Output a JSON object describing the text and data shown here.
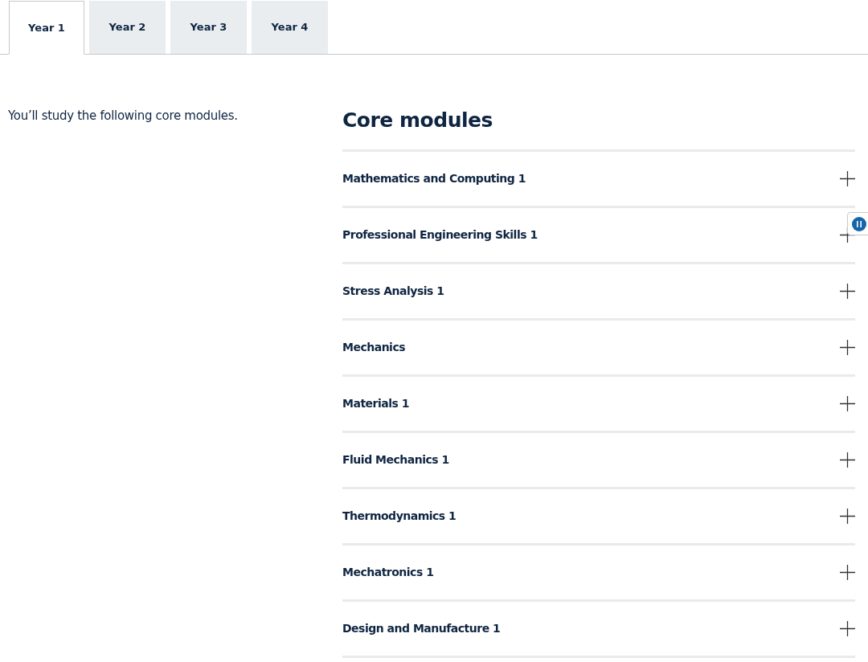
{
  "tabs": [
    {
      "label": "Year 1",
      "selected": true
    },
    {
      "label": "Year 2",
      "selected": false
    },
    {
      "label": "Year 3",
      "selected": false
    },
    {
      "label": "Year 4",
      "selected": false
    }
  ],
  "intro": "You’ll study the following core modules.",
  "section_title": "Core modules",
  "modules": [
    {
      "title": "Mathematics and Computing 1",
      "expanded": false
    },
    {
      "title": "Professional Engineering Skills 1",
      "expanded": false
    },
    {
      "title": "Stress Analysis 1",
      "expanded": false
    },
    {
      "title": "Mechanics",
      "expanded": false
    },
    {
      "title": "Materials 1",
      "expanded": false
    },
    {
      "title": "Fluid Mechanics 1",
      "expanded": false
    },
    {
      "title": "Thermodynamics 1",
      "expanded": false
    },
    {
      "title": "Mechatronics 1",
      "expanded": false
    },
    {
      "title": "Design and Manufacture 1",
      "expanded": false
    }
  ]
}
